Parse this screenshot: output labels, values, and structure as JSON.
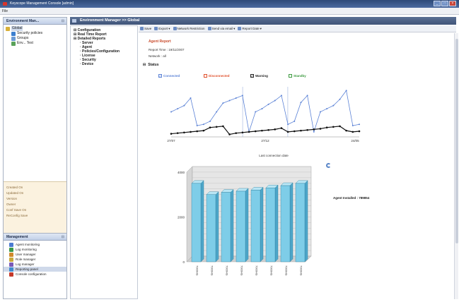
{
  "window": {
    "title": "Keyscope Management Console [admin]",
    "menu": "File"
  },
  "left_pane": {
    "title": "Environment Man...",
    "tree": [
      {
        "label": "Global",
        "level": 0
      },
      {
        "label": "Security policies",
        "level": 1
      },
      {
        "label": "Groups",
        "level": 1
      },
      {
        "label": "Env... Test",
        "level": 1
      }
    ],
    "properties": [
      "Created On",
      "Updated On",
      "Version",
      "Owner",
      "Conf Save On",
      "ReConfig Save"
    ],
    "management_title": "Management",
    "management_items": [
      {
        "label": "Agent monitoring",
        "selected": false,
        "color": "#4b7bd0"
      },
      {
        "label": "Log monitoring",
        "selected": false,
        "color": "#3b9a4a"
      },
      {
        "label": "User manager",
        "selected": false,
        "color": "#d08a2c"
      },
      {
        "label": "Role manager",
        "selected": false,
        "color": "#c9a93a"
      },
      {
        "label": "Log manager",
        "selected": false,
        "color": "#7a5ab8"
      },
      {
        "label": "Reporting panel",
        "selected": true,
        "color": "#3f8bcf"
      },
      {
        "label": "Console configuration",
        "selected": false,
        "color": "#c5392b"
      }
    ]
  },
  "main_header": "Environment Manager >> Global",
  "nav": {
    "items": [
      {
        "label": "Configuration",
        "sub": false
      },
      {
        "label": "Real Time Report",
        "sub": false
      },
      {
        "label": "Detailed Reports",
        "sub": false
      },
      {
        "label": "Server",
        "sub": true
      },
      {
        "label": "Agent",
        "sub": true
      },
      {
        "label": "Policies/Configuration",
        "sub": true
      },
      {
        "label": "License",
        "sub": true
      },
      {
        "label": "Security",
        "sub": true
      },
      {
        "label": "Device",
        "sub": true
      }
    ]
  },
  "toolbar": {
    "save": "Save",
    "export": "Export",
    "network_restriction": "Network Restriction",
    "send_email": "Send via email",
    "report_date": "Report Date"
  },
  "report": {
    "title": "Agent Report",
    "report_time": "Report Time : 19/11/2007",
    "network": "Network : all",
    "status_label": "Status",
    "legend": [
      {
        "label": "Connected",
        "color": "#5b82d6",
        "checked": true
      },
      {
        "label": "Disconnected",
        "color": "#e0502c",
        "checked": false
      },
      {
        "label": "Warning",
        "color": "#222222",
        "checked": true
      },
      {
        "label": "Standby",
        "color": "#3c9a3f",
        "checked": false
      }
    ],
    "line_xlabel": "Last connection date",
    "line_ticks": [
      "27/07",
      "27/12",
      "24/05"
    ],
    "agent_total": "Agent Installed : 789854"
  },
  "chart_data": [
    {
      "type": "line",
      "series": [
        {
          "name": "Connected",
          "color": "#5b82d6",
          "values": [
            40,
            45,
            50,
            62,
            18,
            20,
            25,
            40,
            54,
            58,
            62,
            66,
            8,
            40,
            45,
            52,
            58,
            66,
            20,
            25,
            55,
            66,
            8,
            40,
            45,
            50,
            60,
            74,
            18,
            20
          ]
        },
        {
          "name": "Warning",
          "color": "#111111",
          "values": [
            5,
            6,
            7,
            8,
            9,
            10,
            15,
            16,
            17,
            4,
            6,
            7,
            8,
            9,
            10,
            11,
            12,
            14,
            8,
            9,
            10,
            11,
            12,
            13,
            15,
            16,
            17,
            10,
            8,
            9
          ]
        }
      ],
      "ylim": [
        0,
        80
      ]
    },
    {
      "type": "bar",
      "categories": [
        "7000HS",
        "7000HS",
        "7000HS",
        "7000HS",
        "7000HS",
        "7000HS",
        "7000HS",
        "7000HS"
      ],
      "values": [
        3500,
        3000,
        3100,
        3150,
        3200,
        3300,
        3400,
        3500
      ],
      "y_ticks": [
        "4000",
        "2000",
        "0"
      ],
      "ylim": [
        0,
        4000
      ]
    }
  ]
}
